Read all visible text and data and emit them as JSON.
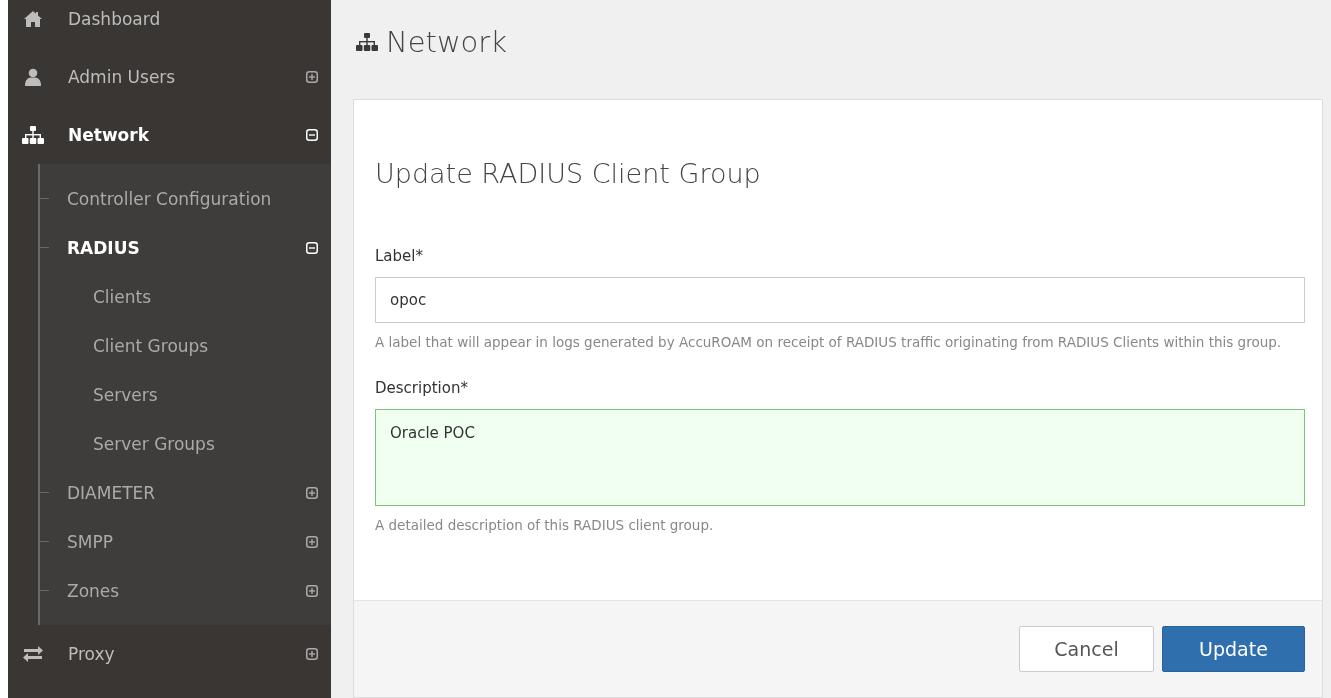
{
  "sidebar": {
    "items": [
      {
        "label": "Dashboard",
        "selected": false
      },
      {
        "label": "Admin Users",
        "selected": false,
        "expanded": false
      },
      {
        "label": "Network",
        "selected": true,
        "expanded": true,
        "children": [
          {
            "label": "Controller Configuration",
            "selected": false
          },
          {
            "label": "RADIUS",
            "selected": true,
            "expanded": true,
            "children": [
              {
                "label": "Clients",
                "selected": false
              },
              {
                "label": "Client Groups",
                "selected": false
              },
              {
                "label": "Servers",
                "selected": false
              },
              {
                "label": "Server Groups",
                "selected": false
              }
            ]
          },
          {
            "label": "DIAMETER",
            "selected": false,
            "expanded": false
          },
          {
            "label": "SMPP",
            "selected": false,
            "expanded": false
          },
          {
            "label": "Zones",
            "selected": false,
            "expanded": false
          }
        ]
      },
      {
        "label": "Proxy",
        "selected": false,
        "expanded": false
      }
    ]
  },
  "page": {
    "title": "Network"
  },
  "form": {
    "title": "Update RADIUS Client Group",
    "fields": [
      {
        "kind": "input",
        "label": "Label*",
        "value": "opoc",
        "valid": false,
        "help": "A label that will appear in logs generated by AccuROAM on receipt of RADIUS traffic originating from RADIUS Clients within this group."
      },
      {
        "kind": "textarea",
        "label": "Description*",
        "value": "Oracle POC",
        "valid": true,
        "help": "A detailed description of this RADIUS client group."
      }
    ],
    "buttons": [
      {
        "label": "Cancel",
        "kind": "default"
      },
      {
        "label": "Update",
        "kind": "primary"
      }
    ]
  }
}
